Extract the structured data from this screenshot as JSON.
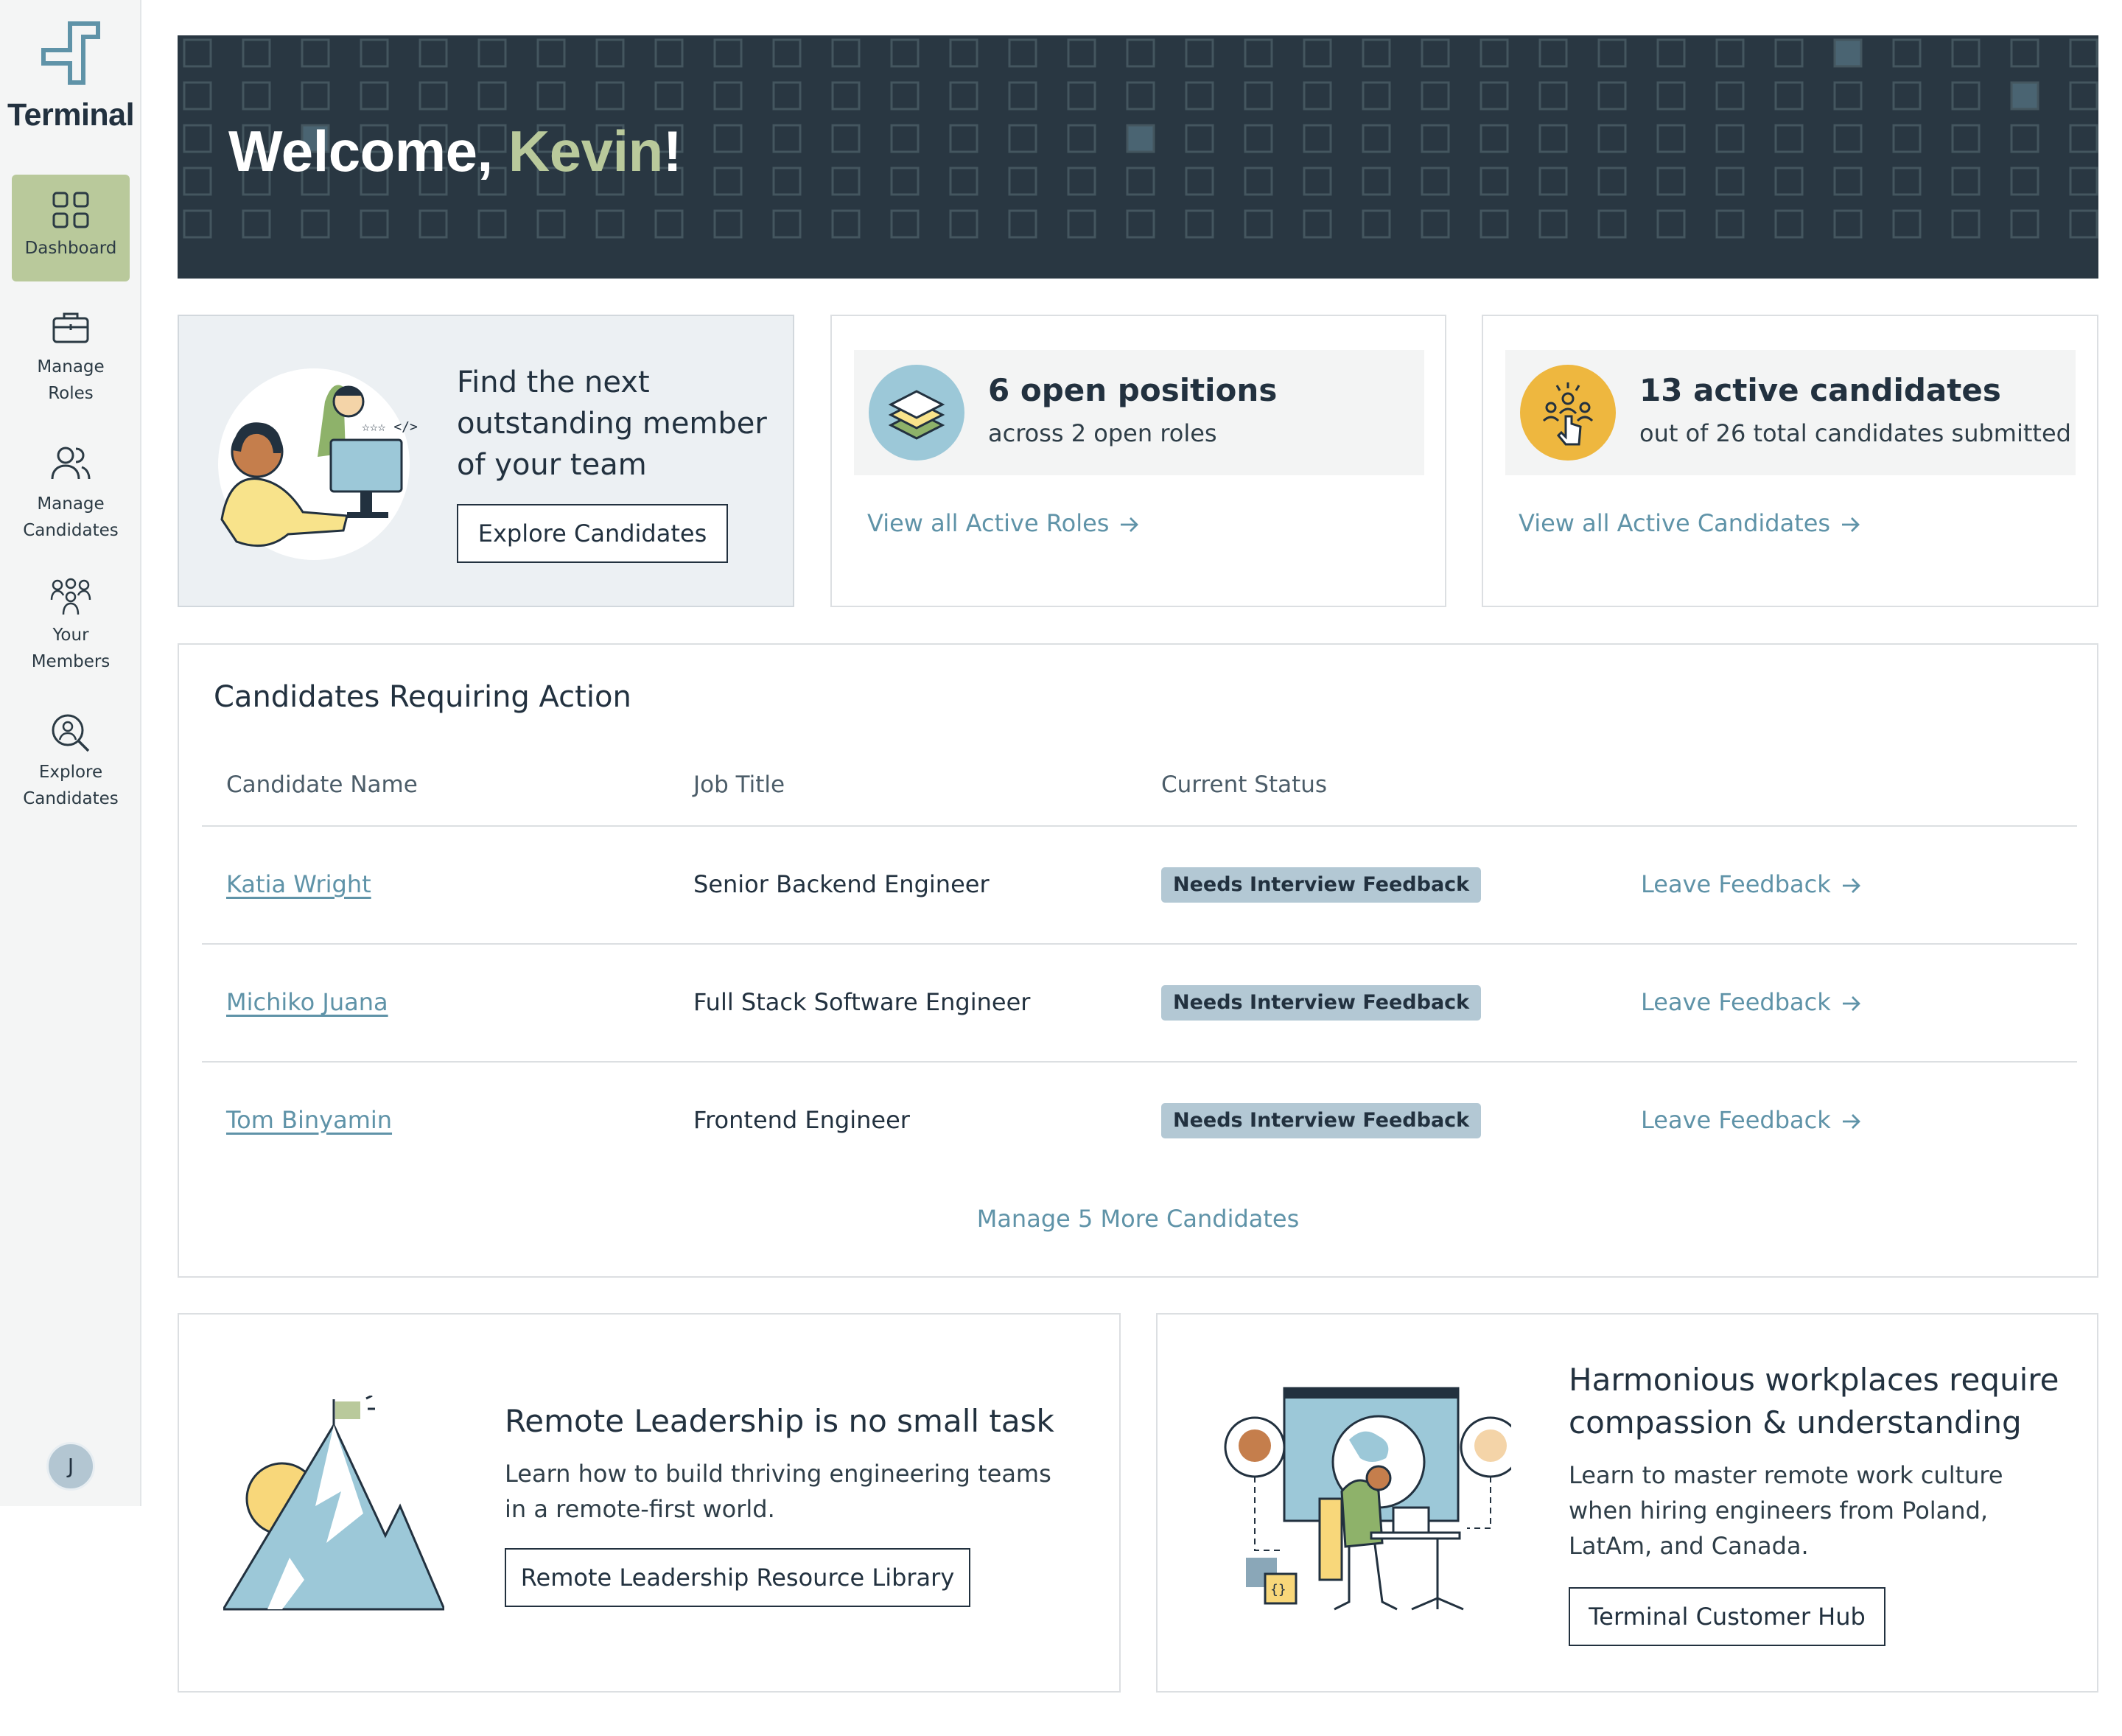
{
  "app": {
    "name": "Terminal"
  },
  "sidebar": {
    "items": [
      {
        "label": "Dashboard",
        "icon": "dashboard-grid-icon",
        "active": true
      },
      {
        "label": "Manage Roles",
        "icon": "briefcase-icon",
        "active": false
      },
      {
        "label": "Manage Candidates",
        "icon": "users-icon",
        "active": false
      },
      {
        "label": "Your Members",
        "icon": "members-icon",
        "active": false
      },
      {
        "label": "Explore Candidates",
        "icon": "search-person-icon",
        "active": false
      }
    ],
    "user_initial": "J"
  },
  "hero": {
    "greeting": "Welcome, ",
    "name": "Kevin",
    "punctuation": "!"
  },
  "promo_card": {
    "heading": "Find the next outstanding member of your team",
    "button_label": "Explore Candidates"
  },
  "roles_card": {
    "title": "6 open positions",
    "subtitle": "across 2 open roles",
    "link": "View all Active Roles",
    "icon": "layers-icon",
    "color": "#9cc8d8"
  },
  "candidates_card": {
    "title": "13 active candidates",
    "subtitle": "out of 26 total candidates submitted",
    "link": "View all Active Candidates",
    "icon": "pointer-selection-icon",
    "color": "#eeb73f"
  },
  "action_table": {
    "title": "Candidates Requiring Action",
    "columns": [
      "Candidate Name",
      "Job Title",
      "Current Status"
    ],
    "rows": [
      {
        "name": "Katia Wright",
        "job": "Senior Backend Engineer",
        "status": "Needs Interview Feedback",
        "action": "Leave Feedback"
      },
      {
        "name": "Michiko Juana",
        "job": "Full Stack Software Engineer",
        "status": "Needs Interview Feedback",
        "action": "Leave Feedback"
      },
      {
        "name": "Tom Binyamin",
        "job": "Frontend Engineer",
        "status": "Needs Interview Feedback",
        "action": "Leave Feedback"
      }
    ],
    "more_link": "Manage 5 More Candidates"
  },
  "resources": [
    {
      "title": "Remote Leadership is no small task",
      "body": "Learn how to build thriving engineering teams in a remote-first world.",
      "button_label": "Remote Leadership Resource Library"
    },
    {
      "title": "Harmonious workplaces require compassion & understanding",
      "body": "Learn to master remote work culture when hiring engineers from Poland, LatAm, and Canada.",
      "button_label": "Terminal Customer Hub"
    }
  ],
  "colors": {
    "accent_green": "#b9c99b",
    "link_blue": "#5f93a8",
    "hero_bg": "#293742",
    "badge_bg": "#b3c8d4"
  }
}
